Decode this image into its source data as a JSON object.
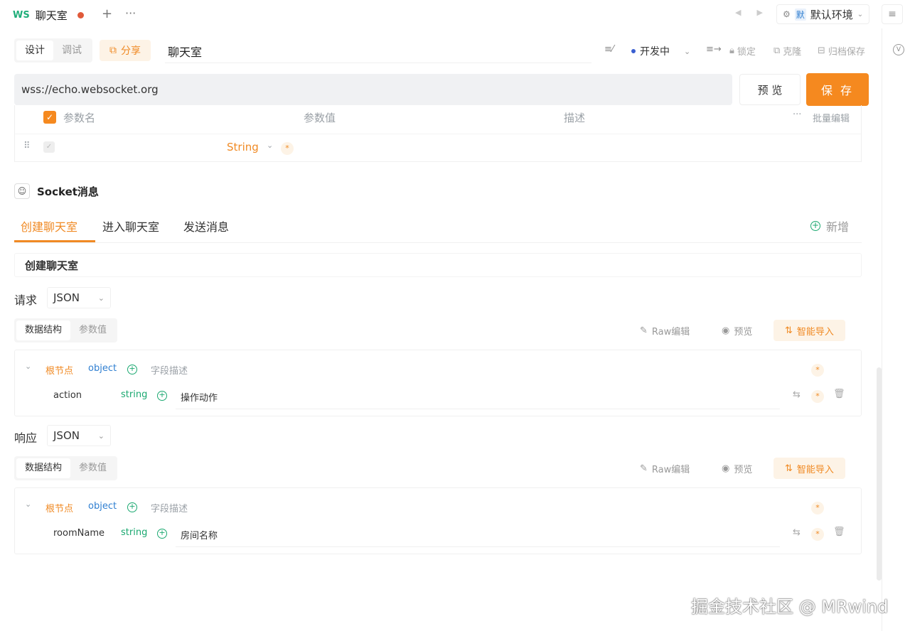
{
  "tab": {
    "protocol": "WS",
    "title": "聊天室"
  },
  "top": {
    "plus": "+",
    "more": "···",
    "env_badge": "默",
    "env_label": "默认环境",
    "menu_icon": "≡"
  },
  "mode": {
    "design": "设计",
    "debug": "调试"
  },
  "share_label": "分享",
  "doc_name": "聊天室",
  "status_label": "开发中",
  "tools": {
    "lock": "锁定",
    "clone": "克隆",
    "archive": "归档保存"
  },
  "url": "wss://echo.websocket.org",
  "buttons": {
    "preview": "预 览",
    "save": "保 存"
  },
  "params": {
    "headers": {
      "name": "参数名",
      "value": "参数值",
      "desc": "描述",
      "bulk_edit": "批量编辑"
    },
    "row": {
      "type": "String"
    }
  },
  "socket": {
    "title": "Socket消息",
    "tabs": [
      "创建聊天室",
      "进入聊天室",
      "发送消息"
    ],
    "add_label": "新增",
    "message_name": "创建聊天室"
  },
  "request": {
    "label": "请求",
    "format": "JSON",
    "sub_tabs": [
      "数据结构",
      "参数值"
    ],
    "actions": {
      "raw": "Raw编辑",
      "preview": "预览",
      "smart": "智能导入"
    },
    "root": {
      "name": "根节点",
      "type": "object",
      "desc_placeholder": "字段描述"
    },
    "field": {
      "name": "action",
      "type": "string",
      "desc": "操作动作"
    }
  },
  "response": {
    "label": "响应",
    "format": "JSON",
    "sub_tabs": [
      "数据结构",
      "参数值"
    ],
    "actions": {
      "raw": "Raw编辑",
      "preview": "预览",
      "smart": "智能导入"
    },
    "root": {
      "name": "根节点",
      "type": "object",
      "desc_placeholder": "字段描述"
    },
    "field": {
      "name": "roomName",
      "type": "string",
      "desc": "房间名称"
    }
  },
  "watermark": "掘金技术社区 @ MRwind",
  "colors": {
    "accent": "#f5891f",
    "ws_green": "#1fae7a",
    "type_blue": "#2f7fd1",
    "type_green": "#1aa870"
  }
}
